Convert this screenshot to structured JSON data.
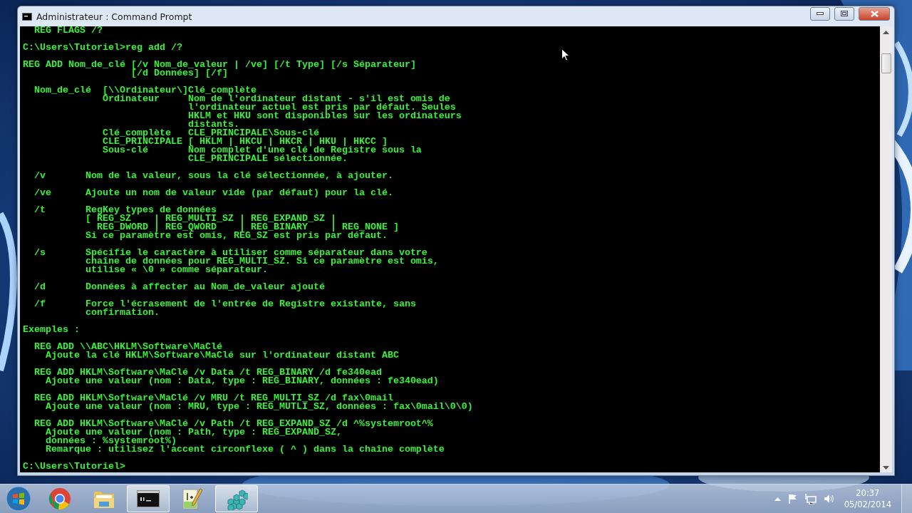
{
  "window": {
    "title": "Administrateur : Command Prompt"
  },
  "console": {
    "blocks": [
      {
        "lines": [
          "  REG FLAGS /?"
        ]
      },
      {
        "lines": [
          "C:\\Users\\Tutoriel>reg add /?"
        ]
      },
      {
        "lines": [
          "REG ADD Nom_de_clé [/v Nom_de_valeur | /ve] [/t Type] [/s Séparateur]",
          "                   [/d Données] [/f]"
        ]
      },
      {
        "lines": [
          "  Nom_de_clé  [\\\\Ordinateur\\]Clé_complète",
          "              Ordinateur     Nom de l'ordinateur distant - s'il est omis de",
          "                             l'ordinateur actuel est pris par défaut. Seules",
          "                             HKLM et HKU sont disponibles sur les ordinateurs",
          "                             distants.",
          "              Clé_complète   CLE_PRINCIPALE\\Sous-clé",
          "              CLE_PRINCIPALE [ HKLM | HKCU | HKCR | HKU | HKCC ]",
          "              Sous-clé       Nom complet d'une clé de Registre sous la",
          "                             CLE_PRINCIPALE sélectionnée."
        ]
      },
      {
        "lines": [
          "  /v       Nom de la valeur, sous la clé sélectionnée, à ajouter."
        ]
      },
      {
        "lines": [
          "  /ve      Ajoute un nom de valeur vide (par défaut) pour la clé."
        ]
      },
      {
        "lines": [
          "  /t       RegKey types de données",
          "           [ REG_SZ    | REG_MULTI_SZ | REG_EXPAND_SZ |",
          "             REG_DWORD | REG_QWORD    | REG_BINARY    | REG_NONE ]",
          "           Si ce paramètre est omis, REG_SZ est pris par défaut."
        ]
      },
      {
        "lines": [
          "  /s       Spécifie le caractère à utiliser comme séparateur dans votre",
          "           chaîne de données pour REG_MULTI_SZ. Si ce paramètre est omis,",
          "           utilise « \\0 » comme séparateur."
        ]
      },
      {
        "lines": [
          "  /d       Données à affecter au Nom_de_valeur ajouté"
        ]
      },
      {
        "lines": [
          "  /f       Force l'écrasement de l'entrée de Registre existante, sans",
          "           confirmation."
        ]
      },
      {
        "lines": [
          "Exemples :"
        ]
      },
      {
        "lines": [
          "  REG ADD \\\\ABC\\HKLM\\Software\\MaClé",
          "    Ajoute la clé HKLM\\Software\\MaClé sur l'ordinateur distant ABC"
        ]
      },
      {
        "lines": [
          "  REG ADD HKLM\\Software\\MaClé /v Data /t REG_BINARY /d fe340ead",
          "    Ajoute une valeur (nom : Data, type : REG_BINARY, données : fe340ead)"
        ]
      },
      {
        "lines": [
          "  REG ADD HKLM\\Software\\MaClé /v MRU /t REG_MULTI_SZ /d fax\\0mail",
          "    Ajoute une valeur (nom : MRU, type : REG_MUTLI_SZ, données : fax\\0mail\\0\\0)"
        ]
      },
      {
        "lines": [
          "  REG ADD HKLM\\Software\\MaClé /v Path /t REG_EXPAND_SZ /d ^%systemroot^%",
          "    Ajoute une valeur (nom : Path, type : REG_EXPAND_SZ,",
          "    données : %systemroot%)",
          "    Remarque : utilisez l'accent circonflexe ( ^ ) dans la chaîne complète"
        ]
      },
      {
        "lines": [
          "C:\\Users\\Tutoriel>"
        ]
      }
    ]
  },
  "taskbar": {
    "items": [
      {
        "kind": "start",
        "open": false
      },
      {
        "kind": "browser",
        "open": false
      },
      {
        "kind": "folder",
        "open": false
      },
      {
        "kind": "terminal",
        "open": true
      },
      {
        "kind": "notepad",
        "open": false
      },
      {
        "kind": "registry",
        "open": true
      }
    ]
  },
  "tray": {
    "time": "20:37",
    "date": "05/02/2014"
  }
}
